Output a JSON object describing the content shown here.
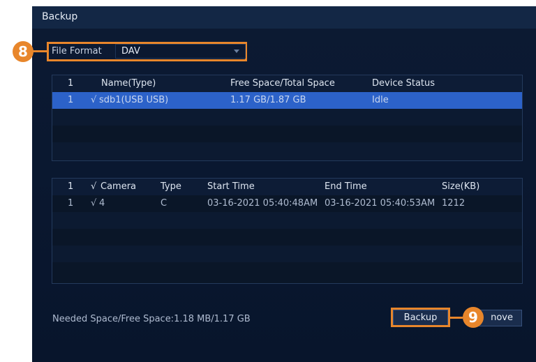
{
  "dialog": {
    "title": "Backup"
  },
  "format": {
    "label": "File Format",
    "value": "DAV"
  },
  "callouts": {
    "step8": "8",
    "step9": "9"
  },
  "devices": {
    "headers": [
      "1",
      "Name(Type)",
      "Free Space/Total Space",
      "Device Status"
    ],
    "rows": [
      {
        "index": "1",
        "check": "√",
        "name": "sdb1(USB USB)",
        "space": "1.17 GB/1.87 GB",
        "status": "Idle"
      }
    ]
  },
  "files": {
    "headers": {
      "index": "1",
      "check": "√",
      "camera": "Camera",
      "type": "Type",
      "start": "Start Time",
      "end": "End Time",
      "size": "Size(KB)"
    },
    "rows": [
      {
        "index": "1",
        "check": "√",
        "camera": "4",
        "type": "C",
        "start": "03-16-2021 05:40:48AM",
        "end": "03-16-2021 05:40:53AM",
        "size": "1212"
      }
    ]
  },
  "footer": {
    "needed_space": "Needed Space/Free Space:1.18 MB/1.17 GB",
    "backup_label": "Backup",
    "remove_label": "nove"
  },
  "colors": {
    "accent": "#e8862b",
    "selection": "#2c62c9",
    "background": "#0c1a33"
  }
}
